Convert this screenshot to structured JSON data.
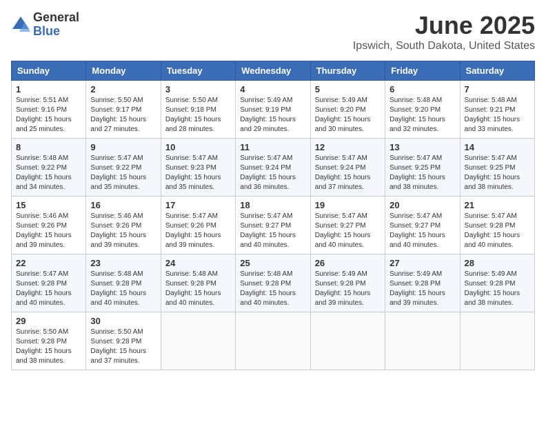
{
  "logo": {
    "general": "General",
    "blue": "Blue"
  },
  "title": "June 2025",
  "subtitle": "Ipswich, South Dakota, United States",
  "weekdays": [
    "Sunday",
    "Monday",
    "Tuesday",
    "Wednesday",
    "Thursday",
    "Friday",
    "Saturday"
  ],
  "weeks": [
    [
      {
        "day": "1",
        "sunrise": "5:51 AM",
        "sunset": "9:16 PM",
        "daylight": "15 hours and 25 minutes."
      },
      {
        "day": "2",
        "sunrise": "5:50 AM",
        "sunset": "9:17 PM",
        "daylight": "15 hours and 27 minutes."
      },
      {
        "day": "3",
        "sunrise": "5:50 AM",
        "sunset": "9:18 PM",
        "daylight": "15 hours and 28 minutes."
      },
      {
        "day": "4",
        "sunrise": "5:49 AM",
        "sunset": "9:19 PM",
        "daylight": "15 hours and 29 minutes."
      },
      {
        "day": "5",
        "sunrise": "5:49 AM",
        "sunset": "9:20 PM",
        "daylight": "15 hours and 30 minutes."
      },
      {
        "day": "6",
        "sunrise": "5:48 AM",
        "sunset": "9:20 PM",
        "daylight": "15 hours and 32 minutes."
      },
      {
        "day": "7",
        "sunrise": "5:48 AM",
        "sunset": "9:21 PM",
        "daylight": "15 hours and 33 minutes."
      }
    ],
    [
      {
        "day": "8",
        "sunrise": "5:48 AM",
        "sunset": "9:22 PM",
        "daylight": "15 hours and 34 minutes."
      },
      {
        "day": "9",
        "sunrise": "5:47 AM",
        "sunset": "9:22 PM",
        "daylight": "15 hours and 35 minutes."
      },
      {
        "day": "10",
        "sunrise": "5:47 AM",
        "sunset": "9:23 PM",
        "daylight": "15 hours and 35 minutes."
      },
      {
        "day": "11",
        "sunrise": "5:47 AM",
        "sunset": "9:24 PM",
        "daylight": "15 hours and 36 minutes."
      },
      {
        "day": "12",
        "sunrise": "5:47 AM",
        "sunset": "9:24 PM",
        "daylight": "15 hours and 37 minutes."
      },
      {
        "day": "13",
        "sunrise": "5:47 AM",
        "sunset": "9:25 PM",
        "daylight": "15 hours and 38 minutes."
      },
      {
        "day": "14",
        "sunrise": "5:47 AM",
        "sunset": "9:25 PM",
        "daylight": "15 hours and 38 minutes."
      }
    ],
    [
      {
        "day": "15",
        "sunrise": "5:46 AM",
        "sunset": "9:26 PM",
        "daylight": "15 hours and 39 minutes."
      },
      {
        "day": "16",
        "sunrise": "5:46 AM",
        "sunset": "9:26 PM",
        "daylight": "15 hours and 39 minutes."
      },
      {
        "day": "17",
        "sunrise": "5:47 AM",
        "sunset": "9:26 PM",
        "daylight": "15 hours and 39 minutes."
      },
      {
        "day": "18",
        "sunrise": "5:47 AM",
        "sunset": "9:27 PM",
        "daylight": "15 hours and 40 minutes."
      },
      {
        "day": "19",
        "sunrise": "5:47 AM",
        "sunset": "9:27 PM",
        "daylight": "15 hours and 40 minutes."
      },
      {
        "day": "20",
        "sunrise": "5:47 AM",
        "sunset": "9:27 PM",
        "daylight": "15 hours and 40 minutes."
      },
      {
        "day": "21",
        "sunrise": "5:47 AM",
        "sunset": "9:28 PM",
        "daylight": "15 hours and 40 minutes."
      }
    ],
    [
      {
        "day": "22",
        "sunrise": "5:47 AM",
        "sunset": "9:28 PM",
        "daylight": "15 hours and 40 minutes."
      },
      {
        "day": "23",
        "sunrise": "5:48 AM",
        "sunset": "9:28 PM",
        "daylight": "15 hours and 40 minutes."
      },
      {
        "day": "24",
        "sunrise": "5:48 AM",
        "sunset": "9:28 PM",
        "daylight": "15 hours and 40 minutes."
      },
      {
        "day": "25",
        "sunrise": "5:48 AM",
        "sunset": "9:28 PM",
        "daylight": "15 hours and 40 minutes."
      },
      {
        "day": "26",
        "sunrise": "5:49 AM",
        "sunset": "9:28 PM",
        "daylight": "15 hours and 39 minutes."
      },
      {
        "day": "27",
        "sunrise": "5:49 AM",
        "sunset": "9:28 PM",
        "daylight": "15 hours and 39 minutes."
      },
      {
        "day": "28",
        "sunrise": "5:49 AM",
        "sunset": "9:28 PM",
        "daylight": "15 hours and 38 minutes."
      }
    ],
    [
      {
        "day": "29",
        "sunrise": "5:50 AM",
        "sunset": "9:28 PM",
        "daylight": "15 hours and 38 minutes."
      },
      {
        "day": "30",
        "sunrise": "5:50 AM",
        "sunset": "9:28 PM",
        "daylight": "15 hours and 37 minutes."
      },
      null,
      null,
      null,
      null,
      null
    ]
  ]
}
